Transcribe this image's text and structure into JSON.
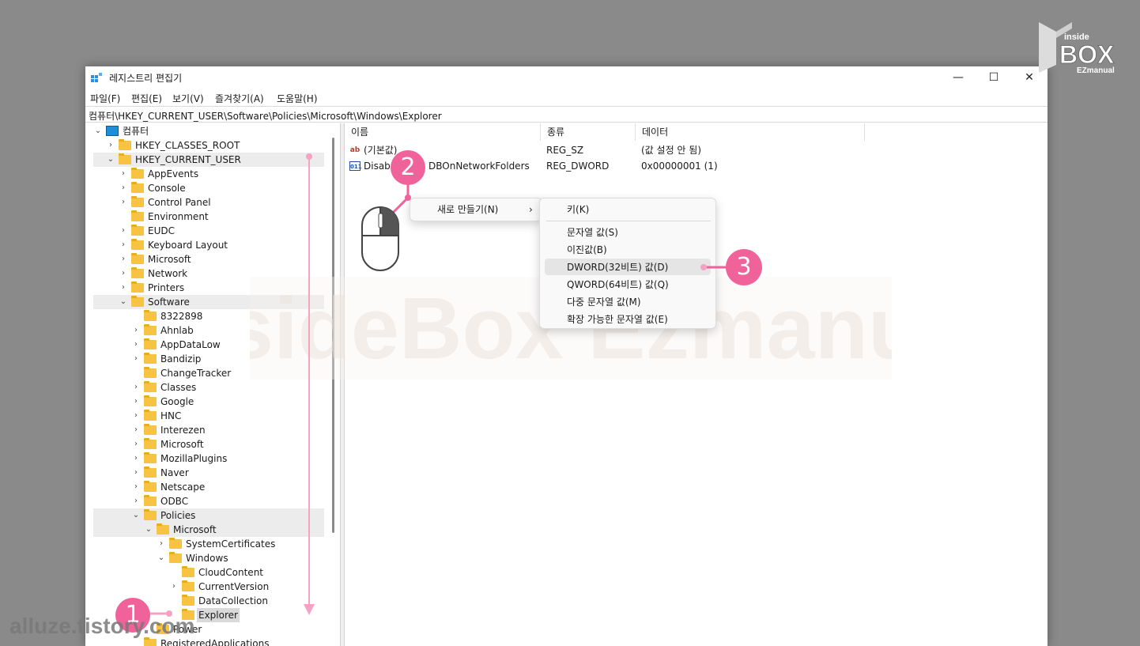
{
  "window": {
    "title": "레지스트리 편집기",
    "minimize": "—",
    "maximize": "☐",
    "close": "✕"
  },
  "menu": [
    "파일(F)",
    "편집(E)",
    "보기(V)",
    "즐겨찾기(A)",
    "도움말(H)"
  ],
  "address": "컴퓨터\\HKEY_CURRENT_USER\\Software\\Policies\\Microsoft\\Windows\\Explorer",
  "tree": [
    {
      "label": "컴퓨터",
      "level": 0,
      "chev": "v",
      "icon": "computer"
    },
    {
      "label": "HKEY_CLASSES_ROOT",
      "level": 1,
      "chev": ">"
    },
    {
      "label": "HKEY_CURRENT_USER",
      "level": 1,
      "chev": "v",
      "highlight": true
    },
    {
      "label": "AppEvents",
      "level": 2,
      "chev": ">"
    },
    {
      "label": "Console",
      "level": 2,
      "chev": ">"
    },
    {
      "label": "Control Panel",
      "level": 2,
      "chev": ">"
    },
    {
      "label": "Environment",
      "level": 2,
      "chev": ""
    },
    {
      "label": "EUDC",
      "level": 2,
      "chev": ">"
    },
    {
      "label": "Keyboard Layout",
      "level": 2,
      "chev": ">"
    },
    {
      "label": "Microsoft",
      "level": 2,
      "chev": ">"
    },
    {
      "label": "Network",
      "level": 2,
      "chev": ">"
    },
    {
      "label": "Printers",
      "level": 2,
      "chev": ">"
    },
    {
      "label": "Software",
      "level": 2,
      "chev": "v",
      "highlight": true
    },
    {
      "label": "8322898",
      "level": 3,
      "chev": ""
    },
    {
      "label": "Ahnlab",
      "level": 3,
      "chev": ">"
    },
    {
      "label": "AppDataLow",
      "level": 3,
      "chev": ">"
    },
    {
      "label": "Bandizip",
      "level": 3,
      "chev": ">"
    },
    {
      "label": "ChangeTracker",
      "level": 3,
      "chev": ""
    },
    {
      "label": "Classes",
      "level": 3,
      "chev": ">"
    },
    {
      "label": "Google",
      "level": 3,
      "chev": ">"
    },
    {
      "label": "HNC",
      "level": 3,
      "chev": ">"
    },
    {
      "label": "Interezen",
      "level": 3,
      "chev": ">"
    },
    {
      "label": "Microsoft",
      "level": 3,
      "chev": ">"
    },
    {
      "label": "MozillaPlugins",
      "level": 3,
      "chev": ">"
    },
    {
      "label": "Naver",
      "level": 3,
      "chev": ">"
    },
    {
      "label": "Netscape",
      "level": 3,
      "chev": ">"
    },
    {
      "label": "ODBC",
      "level": 3,
      "chev": ">"
    },
    {
      "label": "Policies",
      "level": 3,
      "chev": "v",
      "highlight": true
    },
    {
      "label": "Microsoft",
      "level": 4,
      "chev": "v",
      "highlight": true
    },
    {
      "label": "SystemCertificates",
      "level": 5,
      "chev": ">"
    },
    {
      "label": "Windows",
      "level": 5,
      "chev": "v"
    },
    {
      "label": "CloudContent",
      "level": 6,
      "chev": ""
    },
    {
      "label": "CurrentVersion",
      "level": 6,
      "chev": ">"
    },
    {
      "label": "DataCollection",
      "level": 6,
      "chev": ""
    },
    {
      "label": "Explorer",
      "level": 6,
      "chev": "",
      "selected": true
    },
    {
      "label": "Power",
      "level": 4,
      "chev": ""
    },
    {
      "label": "RegisteredApplications",
      "level": 3,
      "chev": ""
    }
  ],
  "columns": {
    "name": "이름",
    "type": "종류",
    "data": "데이터"
  },
  "values": [
    {
      "icon": "ab",
      "name": "(기본값)",
      "type": "REG_SZ",
      "data": "(값 설정 안 됨)"
    },
    {
      "icon": "011",
      "name": "DisableSearchBoxSuggestionsDBOnNetworkFolders",
      "name_visible_left": "Disab",
      "name_visible_right": "DBOnNetworkFolders",
      "type": "REG_DWORD",
      "data": "0x00000001 (1)"
    }
  ],
  "context_menu": {
    "new_label": "새로 만들기(N)",
    "arrow": "›"
  },
  "submenu": [
    {
      "label": "키(K)"
    },
    {
      "label": "문자열 값(S)"
    },
    {
      "label": "이진값(B)"
    },
    {
      "label": "DWORD(32비트) 값(D)",
      "hover": true
    },
    {
      "label": "QWORD(64비트) 값(Q)"
    },
    {
      "label": "다중 문자열 값(M)"
    },
    {
      "label": "확장 가능한 문자열 값(E)"
    }
  ],
  "badges": [
    "1",
    "2",
    "3"
  ],
  "watermark": "InsideBox Ezmanual",
  "footer_watermark": "alluze.tistory.com",
  "logo": {
    "line1": "inside",
    "line2": "BOX",
    "line3": "EZmanual"
  },
  "colors": {
    "accent": "#f0629a",
    "folder": "#f6c343"
  }
}
